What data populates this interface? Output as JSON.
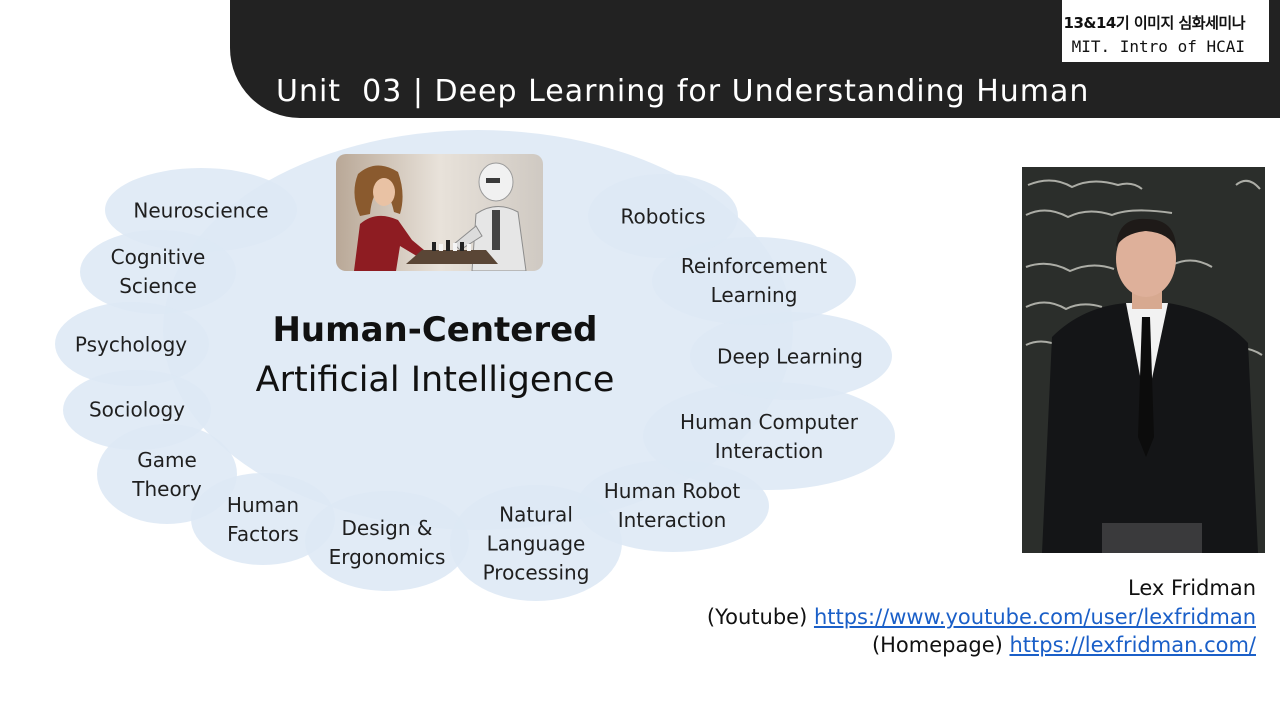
{
  "header": {
    "unit_title": "Unit  03 | Deep Learning for Understanding Human",
    "course_line1": "13&14기 이미지 심화세미나",
    "course_line2": "MIT. Intro of HCAI",
    "bar_color": "#222222"
  },
  "diagram": {
    "center_title": "Human-Centered",
    "center_subtitle": "Artificial Intelligence",
    "bubble_color": "#dde8f5",
    "bubbles": [
      "Neuroscience",
      "Cognitive\nScience",
      "Psychology",
      "Sociology",
      "Game\nTheory",
      "Human\nFactors",
      "Design &\nErgonomics",
      "Natural\nLanguage\nProcessing",
      "Human Robot\nInteraction",
      "Human Computer\nInteraction",
      "Deep Learning",
      "Reinforcement\nLearning",
      "Robotics"
    ]
  },
  "credits": {
    "name": "Lex Fridman",
    "youtube_label": "(Youtube) ",
    "youtube_url": "https://www.youtube.com/user/lexfridman",
    "homepage_label": "(Homepage) ",
    "homepage_url": "https://lexfridman.com/"
  }
}
